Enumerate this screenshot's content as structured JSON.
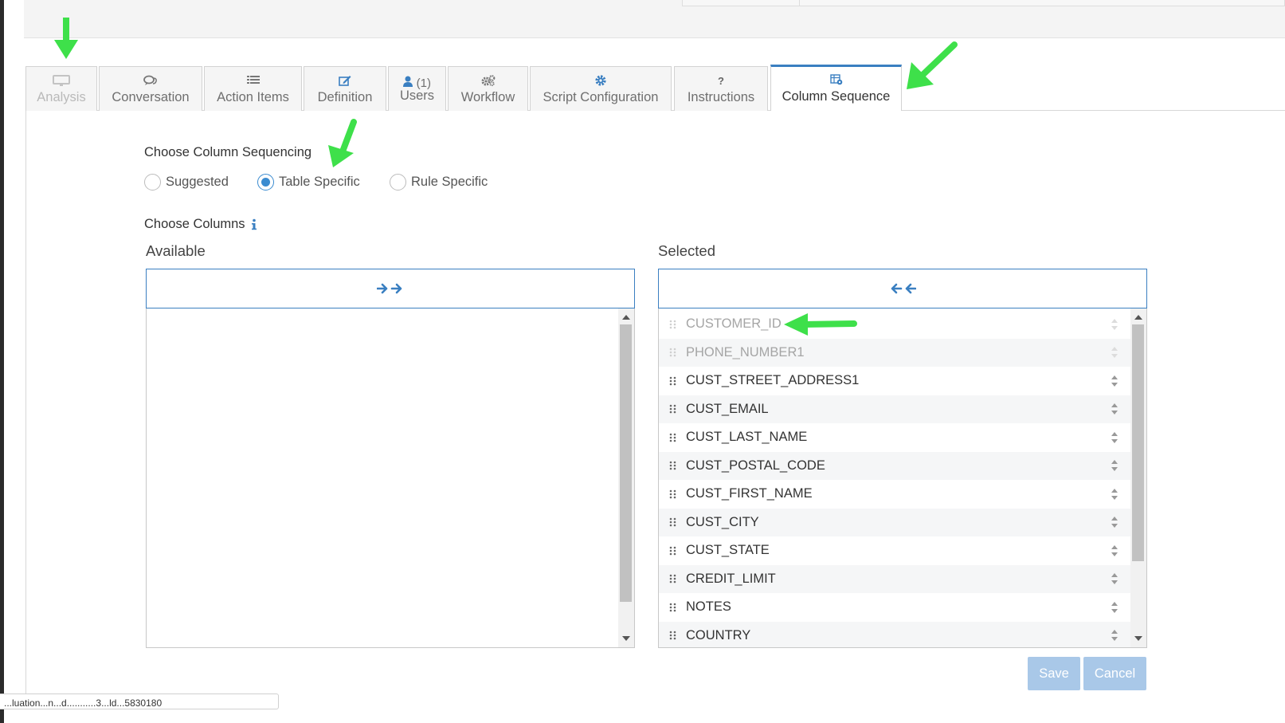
{
  "tabs": [
    {
      "label": "Analysis",
      "icon": "presentation-icon",
      "state": "disabled"
    },
    {
      "label": "Conversation",
      "icon": "comments-icon",
      "state": "normal"
    },
    {
      "label": "Action Items",
      "icon": "list-icon",
      "state": "normal"
    },
    {
      "label": "Definition",
      "icon": "edit-icon",
      "state": "normal"
    },
    {
      "label": "Users",
      "icon": "user-icon",
      "state": "normal",
      "count": "(1)"
    },
    {
      "label": "Workflow",
      "icon": "cogs-icon",
      "state": "normal"
    },
    {
      "label": "Script Configuration",
      "icon": "cog-icon",
      "state": "normal"
    },
    {
      "label": "Instructions",
      "icon": "question-icon",
      "state": "normal"
    },
    {
      "label": "Column Sequence",
      "icon": "table-cog-icon",
      "state": "active"
    }
  ],
  "sequencing": {
    "title": "Choose Column Sequencing",
    "options": [
      {
        "label": "Suggested",
        "selected": false
      },
      {
        "label": "Table Specific",
        "selected": true
      },
      {
        "label": "Rule Specific",
        "selected": false
      }
    ]
  },
  "columns": {
    "title": "Choose Columns",
    "available_label": "Available",
    "selected_label": "Selected",
    "selected_items": [
      {
        "name": "CUSTOMER_ID",
        "locked": true
      },
      {
        "name": "PHONE_NUMBER1",
        "locked": true
      },
      {
        "name": "CUST_STREET_ADDRESS1",
        "locked": false
      },
      {
        "name": "CUST_EMAIL",
        "locked": false
      },
      {
        "name": "CUST_LAST_NAME",
        "locked": false
      },
      {
        "name": "CUST_POSTAL_CODE",
        "locked": false
      },
      {
        "name": "CUST_FIRST_NAME",
        "locked": false
      },
      {
        "name": "CUST_CITY",
        "locked": false
      },
      {
        "name": "CUST_STATE",
        "locked": false
      },
      {
        "name": "CREDIT_LIMIT",
        "locked": false
      },
      {
        "name": "NOTES",
        "locked": false
      },
      {
        "name": "COUNTRY",
        "locked": false
      }
    ]
  },
  "buttons": {
    "save": "Save",
    "cancel": "Cancel"
  },
  "status_bar": {
    "text": "...luation...n...d...........3...ld...5830180"
  },
  "colors": {
    "accent": "#3a7fc1",
    "button": "#a9c8e8",
    "annotation_arrow": "#3ee04a"
  }
}
